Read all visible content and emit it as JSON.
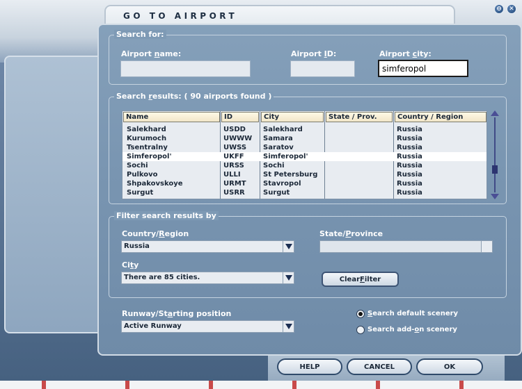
{
  "window": {
    "title": "GO TO AIRPORT"
  },
  "window_controls": {
    "minimize_glyph": "⊖",
    "close_glyph": "✕"
  },
  "search": {
    "legend": "Search for:",
    "airport_name_label_pre": "Airport ",
    "airport_name_label_u": "n",
    "airport_name_label_post": "ame:",
    "airport_name_value": "",
    "airport_id_label_pre": "Airport ",
    "airport_id_label_u": "I",
    "airport_id_label_post": "D:",
    "airport_id_value": "",
    "airport_city_label_pre": "Airport ",
    "airport_city_label_u": "c",
    "airport_city_label_post": "ity:",
    "airport_city_value": "simferopol"
  },
  "results": {
    "legend_pre": "Search ",
    "legend_u": "r",
    "legend_post": "esults: ( 90 airports found )",
    "columns": [
      "Name",
      "ID",
      "City",
      "State / Prov.",
      "Country / Region"
    ],
    "rows": [
      {
        "name": "Salekhard",
        "id": "USDD",
        "city": "Salekhard",
        "state": "",
        "country": "Russia"
      },
      {
        "name": "Kurumoch",
        "id": "UWWW",
        "city": "Samara",
        "state": "",
        "country": "Russia"
      },
      {
        "name": "Tsentralny",
        "id": "UWSS",
        "city": "Saratov",
        "state": "",
        "country": "Russia"
      },
      {
        "name": "Simferopol'",
        "id": "UKFF",
        "city": "Simferopol'",
        "state": "",
        "country": "Russia"
      },
      {
        "name": "Sochi",
        "id": "URSS",
        "city": "Sochi",
        "state": "",
        "country": "Russia"
      },
      {
        "name": "Pulkovo",
        "id": "ULLI",
        "city": "St Petersburg",
        "state": "",
        "country": "Russia"
      },
      {
        "name": "Shpakovskoye",
        "id": "URMT",
        "city": "Stavropol",
        "state": "",
        "country": "Russia"
      },
      {
        "name": "Surgut",
        "id": "USRR",
        "city": "Surgut",
        "state": "",
        "country": "Russia"
      }
    ],
    "selected_row": 3,
    "scroll_position": 0.72
  },
  "filter": {
    "legend": "Filter search results by",
    "country_label_pre": "Country/",
    "country_label_u": "R",
    "country_label_post": "egion",
    "country_value": "Russia",
    "state_label_pre": "State/",
    "state_label_u": "P",
    "state_label_post": "rovince",
    "state_value": "",
    "city_label_pre": "Ci",
    "city_label_u": "t",
    "city_label_post": "y",
    "city_value": "There are 85 cities.",
    "clear_filter_pre": "Clear ",
    "clear_filter_u": "F",
    "clear_filter_post": "ilter"
  },
  "runway": {
    "label_pre": "Runway/St",
    "label_u": "a",
    "label_post": "rting position",
    "value": "Active Runway"
  },
  "scenery": {
    "default_pre": "",
    "default_u": "S",
    "default_post": "earch default scenery",
    "addon_pre": "Search add-",
    "addon_u": "o",
    "addon_post": "n scenery",
    "selected": "default"
  },
  "buttons": {
    "help": "HELP",
    "cancel": "CANCEL",
    "ok": "OK"
  }
}
